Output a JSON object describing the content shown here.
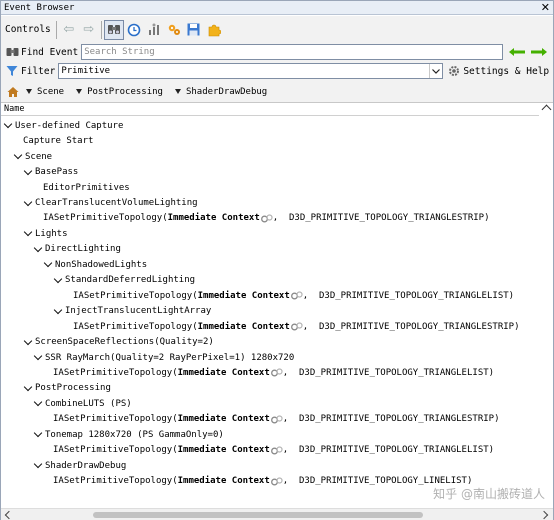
{
  "window": {
    "title": "Event Browser",
    "close": "✕"
  },
  "toolbar": {
    "label": "Controls"
  },
  "find": {
    "label": "Find Event",
    "placeholder": "Search String"
  },
  "filter": {
    "label": "Filter",
    "value": "Primitive",
    "settings_label": "Settings & Help"
  },
  "breadcrumb": [
    "Scene",
    "PostProcessing",
    "ShaderDrawDebug"
  ],
  "tree": {
    "header": "Name",
    "nodes": [
      {
        "depth": 0,
        "expanded": true,
        "text": "User-defined Capture"
      },
      {
        "depth": 1,
        "expanded": false,
        "text": "Capture Start"
      },
      {
        "depth": 1,
        "expanded": true,
        "text": "Scene"
      },
      {
        "depth": 2,
        "expanded": true,
        "text": "BasePass"
      },
      {
        "depth": 3,
        "expanded": false,
        "text": "EditorPrimitives"
      },
      {
        "depth": 2,
        "expanded": true,
        "text": "ClearTranslucentVolumeLighting"
      },
      {
        "depth": 3,
        "expanded": false,
        "call": "IASetPrimitiveTopology(",
        "ctx": "Immediate Context",
        "arg": ",  D3D_PRIMITIVE_TOPOLOGY_TRIANGLESTRIP)"
      },
      {
        "depth": 2,
        "expanded": true,
        "text": "Lights"
      },
      {
        "depth": 3,
        "expanded": true,
        "text": "DirectLighting"
      },
      {
        "depth": 4,
        "expanded": true,
        "text": "NonShadowedLights"
      },
      {
        "depth": 5,
        "expanded": true,
        "text": "StandardDeferredLighting"
      },
      {
        "depth": 6,
        "expanded": false,
        "call": "IASetPrimitiveTopology(",
        "ctx": "Immediate Context",
        "arg": ",  D3D_PRIMITIVE_TOPOLOGY_TRIANGLELIST)"
      },
      {
        "depth": 5,
        "expanded": true,
        "text": "InjectTranslucentLightArray"
      },
      {
        "depth": 6,
        "expanded": false,
        "call": "IASetPrimitiveTopology(",
        "ctx": "Immediate Context",
        "arg": ",  D3D_PRIMITIVE_TOPOLOGY_TRIANGLESTRIP)"
      },
      {
        "depth": 2,
        "expanded": true,
        "text": "ScreenSpaceReflections(Quality=2)"
      },
      {
        "depth": 3,
        "expanded": true,
        "text": "SSR RayMarch(Quality=2 RayPerPixel=1) 1280x720"
      },
      {
        "depth": 4,
        "expanded": false,
        "call": "IASetPrimitiveTopology(",
        "ctx": "Immediate Context",
        "arg": ",  D3D_PRIMITIVE_TOPOLOGY_TRIANGLELIST)"
      },
      {
        "depth": 2,
        "expanded": true,
        "text": "PostProcessing"
      },
      {
        "depth": 3,
        "expanded": true,
        "text": "CombineLUTS (PS)"
      },
      {
        "depth": 4,
        "expanded": false,
        "call": "IASetPrimitiveTopology(",
        "ctx": "Immediate Context",
        "arg": ",  D3D_PRIMITIVE_TOPOLOGY_TRIANGLESTRIP)"
      },
      {
        "depth": 3,
        "expanded": true,
        "text": "Tonemap 1280x720 (PS GammaOnly=0)"
      },
      {
        "depth": 4,
        "expanded": false,
        "call": "IASetPrimitiveTopology(",
        "ctx": "Immediate Context",
        "arg": ",  D3D_PRIMITIVE_TOPOLOGY_TRIANGLELIST)"
      },
      {
        "depth": 3,
        "expanded": true,
        "text": "ShaderDrawDebug"
      },
      {
        "depth": 4,
        "expanded": false,
        "call": "IASetPrimitiveTopology(",
        "ctx": "Immediate Context",
        "arg": ",  D3D_PRIMITIVE_TOPOLOGY_LINELIST)"
      }
    ]
  },
  "watermark": "知乎 @南山搬砖道人",
  "colors": {
    "accent_green": "#44b000",
    "toolbar_bg": "#f2f2f2",
    "title_bg": "#e8eef6"
  }
}
